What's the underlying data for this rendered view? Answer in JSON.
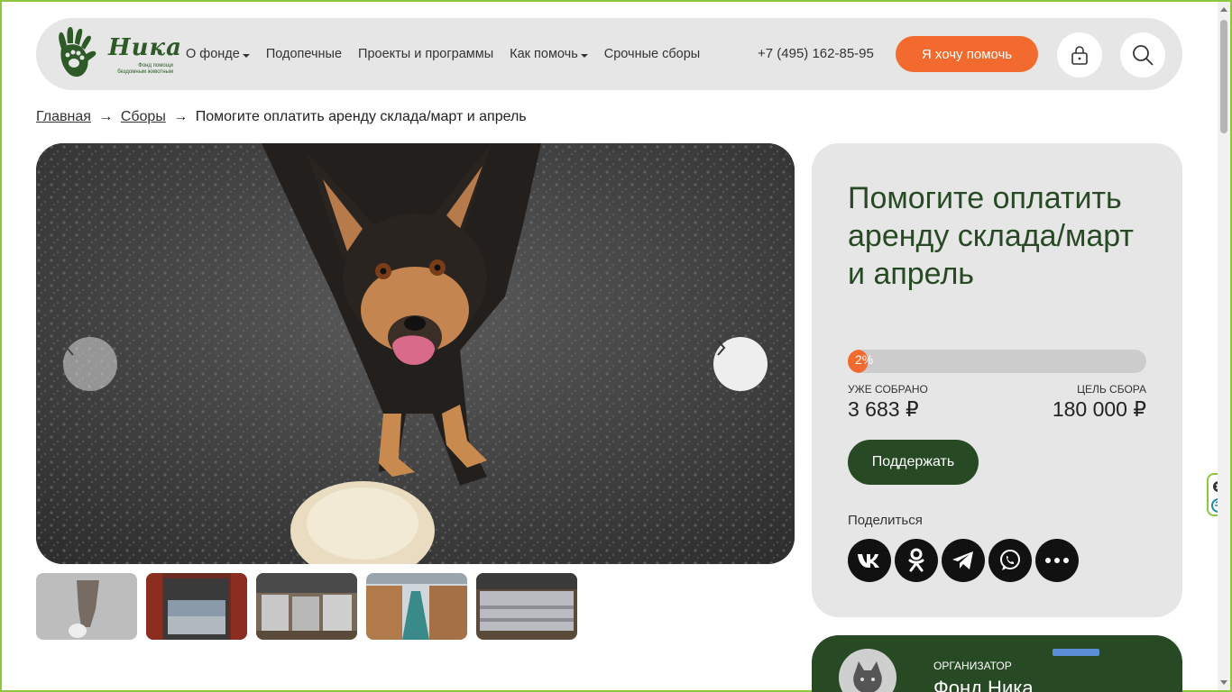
{
  "logo": {
    "word": "Ника",
    "sub": "Фонд помощи бездомным животным"
  },
  "nav": {
    "items": [
      {
        "label": "О фонде",
        "dropdown": true
      },
      {
        "label": "Подопечные",
        "dropdown": false
      },
      {
        "label": "Проекты и программы",
        "dropdown": false
      },
      {
        "label": "Как помочь",
        "dropdown": true
      },
      {
        "label": "Срочные сборы",
        "dropdown": false
      }
    ]
  },
  "header": {
    "phone": "+7 (495) 162-85-95",
    "help_button": "Я хочу помочь",
    "lock_icon": "lock-icon",
    "search_icon": "search-icon"
  },
  "breadcrumb": {
    "home": "Главная",
    "sbory": "Сборы",
    "current": "Помогите оплатить аренду склада/март и апрель",
    "separator": "→"
  },
  "gallery": {
    "prev_icon": "chevron-left-icon",
    "next_icon": "chevron-right-icon",
    "thumbnail_count": 5
  },
  "campaign": {
    "title": "Помогите оплатить аренду склада/март и апрель",
    "progress_percent": 2,
    "progress_label": "2%",
    "collected_label": "УЖЕ СОБРАНО",
    "collected_value": "3 683 ₽",
    "goal_label": "ЦЕЛЬ СБОРА",
    "goal_value": "180 000 ₽",
    "support_button": "Поддержать",
    "share_label": "Поделиться",
    "share_icons": [
      "vk-icon",
      "odnoklassniki-icon",
      "telegram-icon",
      "whatsapp-icon",
      "more-icon"
    ]
  },
  "organizer": {
    "label": "ОРГАНИЗАТОР",
    "name": "Фонд Ника"
  },
  "colors": {
    "accent_orange": "#f26a2e",
    "brand_green": "#274a24",
    "panel_gray": "#e6e6e6",
    "frame_green": "#8dc63f"
  }
}
